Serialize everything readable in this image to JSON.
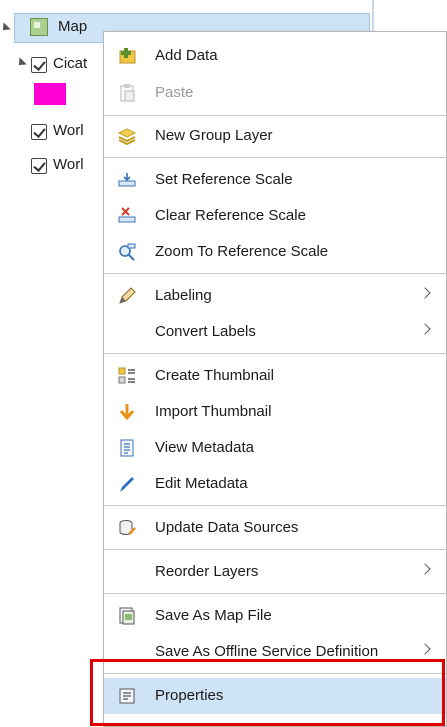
{
  "tree": {
    "map_label": "Map",
    "layers": [
      {
        "label": "Cicat",
        "checked": true
      },
      {
        "label": "Worl",
        "checked": true
      },
      {
        "label": "Worl",
        "checked": true
      }
    ],
    "swatch_color": "#ff00d4"
  },
  "menu": {
    "items": [
      {
        "label": "Add Data",
        "icon": "add-data-icon",
        "enabled": true
      },
      {
        "label": "Paste",
        "icon": "paste-icon",
        "enabled": false
      },
      {
        "label": "New Group Layer",
        "icon": "group-layer-icon",
        "enabled": true
      },
      {
        "label": "Set Reference Scale",
        "icon": "set-scale-icon",
        "enabled": true
      },
      {
        "label": "Clear Reference Scale",
        "icon": "clear-scale-icon",
        "enabled": true
      },
      {
        "label": "Zoom To Reference Scale",
        "icon": "zoom-scale-icon",
        "enabled": true
      },
      {
        "label": "Labeling",
        "icon": "labeling-icon",
        "enabled": true,
        "submenu": true
      },
      {
        "label": "Convert Labels",
        "icon": "",
        "enabled": true,
        "submenu": true
      },
      {
        "label": "Create Thumbnail",
        "icon": "create-thumbnail-icon",
        "enabled": true
      },
      {
        "label": "Import Thumbnail",
        "icon": "import-thumbnail-icon",
        "enabled": true
      },
      {
        "label": "View Metadata",
        "icon": "view-metadata-icon",
        "enabled": true
      },
      {
        "label": "Edit Metadata",
        "icon": "edit-metadata-icon",
        "enabled": true
      },
      {
        "label": "Update Data Sources",
        "icon": "update-sources-icon",
        "enabled": true
      },
      {
        "label": "Reorder Layers",
        "icon": "",
        "enabled": true,
        "submenu": true
      },
      {
        "label": "Save As Map File",
        "icon": "save-map-file-icon",
        "enabled": true
      },
      {
        "label": "Save As Offline Service Definition",
        "icon": "",
        "enabled": true,
        "submenu": true
      },
      {
        "label": "Properties",
        "icon": "properties-icon",
        "enabled": true,
        "highlighted": true
      }
    ]
  },
  "colors": {
    "highlight": "#cfe3f7",
    "annotation_box": "#e10000",
    "accent": "#1e88e5"
  }
}
